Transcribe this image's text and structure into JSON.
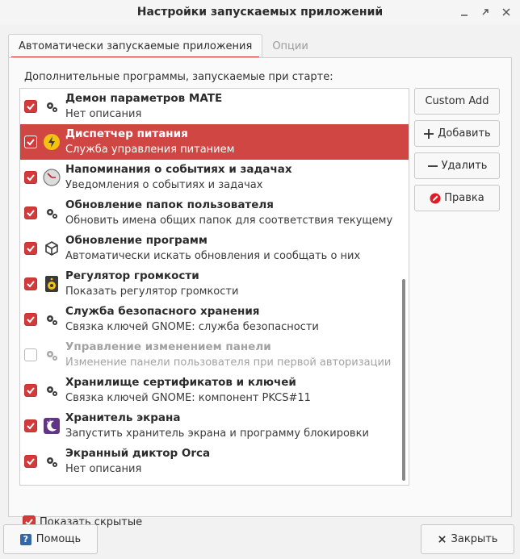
{
  "window": {
    "title": "Настройки запускаемых приложений"
  },
  "tabs": [
    {
      "label": "Автоматически запускаемые приложения",
      "active": true
    },
    {
      "label": "Опции",
      "active": false
    }
  ],
  "list_caption": "Дополнительные программы, запускаемые при старте:",
  "programs": [
    {
      "name": "Демон параметров MATE",
      "description": "Нет описания",
      "enabled": true,
      "icon": "gear-icon"
    },
    {
      "name": "Диспетчер питания",
      "description": "Служба управления питанием",
      "enabled": true,
      "icon": "power-icon",
      "selected": true
    },
    {
      "name": "Напоминания о событиях и задачах",
      "description": "Уведомления о событиях и задачах",
      "enabled": true,
      "icon": "clock-icon"
    },
    {
      "name": "Обновление папок пользователя",
      "description": "Обновить имена общих папок для соответствия текущему яз...",
      "enabled": true,
      "icon": "gear-icon"
    },
    {
      "name": "Обновление программ",
      "description": "Автоматически искать обновления и сообщать о них",
      "enabled": true,
      "icon": "package-icon"
    },
    {
      "name": "Регулятор громкости",
      "description": "Показать регулятор громкости",
      "enabled": true,
      "icon": "speaker-icon"
    },
    {
      "name": "Служба безопасного хранения",
      "description": "Связка ключей GNOME: служба безопасности",
      "enabled": true,
      "icon": "gear-icon"
    },
    {
      "name": "Управление изменением панели",
      "description": "Изменение панели пользователя при первой авторизации",
      "enabled": false,
      "icon": "gear-icon"
    },
    {
      "name": "Хранилище сертификатов и ключей",
      "description": "Связка ключей GNOME: компонент PKCS#11",
      "enabled": true,
      "icon": "gear-icon"
    },
    {
      "name": "Хранитель экрана",
      "description": "Запустить хранитель экрана и программу блокировки",
      "enabled": true,
      "icon": "screensaver-icon"
    },
    {
      "name": "Экранный диктор Orca",
      "description": "Нет описания",
      "enabled": true,
      "icon": "gear-icon"
    }
  ],
  "side_buttons": {
    "custom_add": "Custom Add",
    "add": "Добавить",
    "remove": "Удалить",
    "edit": "Правка"
  },
  "show_hidden": {
    "label": "Показать скрытые",
    "checked": true
  },
  "bottom_buttons": {
    "help": "Помощь",
    "close": "Закрыть"
  },
  "colors": {
    "accent": "#d33b3b",
    "selection": "#d04643"
  }
}
